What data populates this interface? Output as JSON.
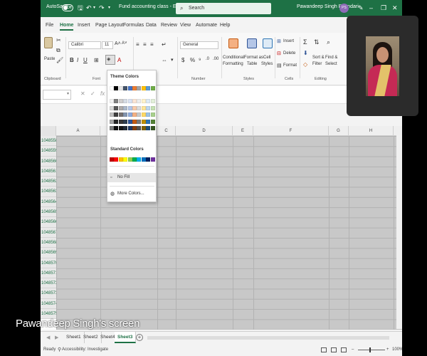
{
  "titlebar": {
    "autosave_label": "AutoSave",
    "autosave_state": "Off",
    "doc_title": "Fund accounting class  -  Excel",
    "search_placeholder": "Search",
    "user_name": "Pawandeep Singh Bhandari",
    "user_initials": "PS"
  },
  "menu_tabs": [
    "File",
    "Home",
    "Insert",
    "Page Layout",
    "Formulas",
    "Data",
    "Review",
    "View",
    "Automate",
    "Help"
  ],
  "ribbon": {
    "paste_label": "Paste",
    "font_name": "Calibri",
    "font_size": "11",
    "number_format": "General",
    "conditional_formatting": [
      "Conditional",
      "Formatting"
    ],
    "format_as_table": [
      "Format as",
      "Table"
    ],
    "cell_styles": [
      "Cell",
      "Styles"
    ],
    "insert_label": "Insert",
    "delete_label": "Delete",
    "format_label": "Format",
    "sort_filter": [
      "Sort &",
      "Filter"
    ],
    "find_select": [
      "Find &",
      "Select"
    ],
    "groups": {
      "clipboard": "Clipboard",
      "font": "Font",
      "number": "Number",
      "styles": "Styles",
      "cells": "Cells",
      "editing": "Editing"
    }
  },
  "columns": [
    "A",
    "C",
    "D",
    "E",
    "F",
    "G",
    "H"
  ],
  "rows": [
    "1048558",
    "1048559",
    "1048560",
    "1048561",
    "1048562",
    "1048563",
    "1048564",
    "1048565",
    "1048566",
    "1048567",
    "1048568",
    "1048569",
    "1048570",
    "1048571",
    "1048572",
    "1048573",
    "1048574",
    "1048575"
  ],
  "color_menu": {
    "theme_heading": "Theme Colors",
    "standard_heading": "Standard Colors",
    "no_fill": "No Fill",
    "more_colors": "More Colors...",
    "theme_top": [
      "#ffffff",
      "#000000",
      "#e7e6e6",
      "#44546a",
      "#4472c4",
      "#ed7d31",
      "#a5a5a5",
      "#ffc000",
      "#5b9bd5",
      "#70ad47"
    ],
    "theme_shades": [
      [
        "#f2f2f2",
        "#808080",
        "#d0cece",
        "#d6dce4",
        "#d9e2f3",
        "#fbe5d5",
        "#ededed",
        "#fff2cc",
        "#deebf6",
        "#e2efd9"
      ],
      [
        "#d8d8d8",
        "#595959",
        "#aeabab",
        "#adb9ca",
        "#b4c6e7",
        "#f7cbac",
        "#dbdbdb",
        "#fee599",
        "#bdd7ee",
        "#c5e0b3"
      ],
      [
        "#bfbfbf",
        "#3f3f3f",
        "#757070",
        "#8496b0",
        "#8eaadb",
        "#f4b183",
        "#c9c9c9",
        "#ffd965",
        "#9cc3e5",
        "#a8d08d"
      ],
      [
        "#a5a5a5",
        "#262626",
        "#3a3838",
        "#323f4f",
        "#2f5496",
        "#c55a11",
        "#7b7b7b",
        "#bf9000",
        "#2e75b5",
        "#538135"
      ],
      [
        "#7f7f7f",
        "#0c0c0c",
        "#171616",
        "#222a35",
        "#1e3864",
        "#833c0b",
        "#525252",
        "#7f6000",
        "#1e4e79",
        "#375623"
      ]
    ],
    "standard": [
      "#c00000",
      "#ff0000",
      "#ffc000",
      "#ffff00",
      "#92d050",
      "#00b050",
      "#00b0f0",
      "#0070c0",
      "#002060",
      "#7030a0"
    ]
  },
  "sheets": [
    "Sheet1",
    "Sheet2",
    "Sheet4",
    "Sheet3"
  ],
  "active_sheet": "Sheet3",
  "status": {
    "ready": "Ready",
    "accessibility": "Accessibility: Investigate",
    "zoom": "100%"
  },
  "caption": "Pawandeep Singh's screen",
  "accent_color": "#1e7145"
}
